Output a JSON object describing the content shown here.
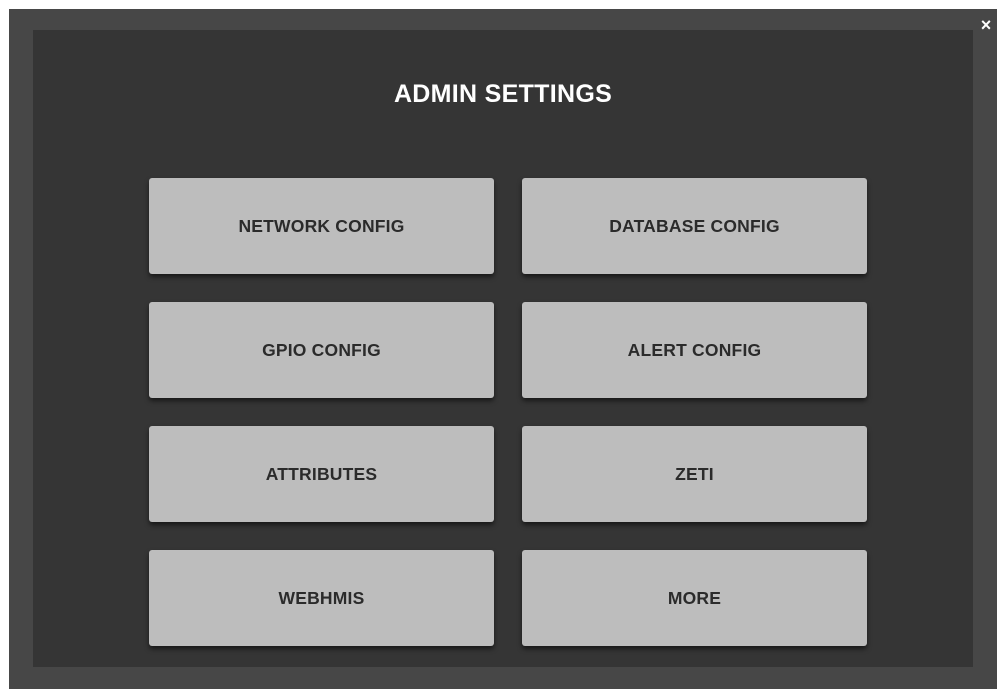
{
  "modal": {
    "title": "ADMIN SETTINGS",
    "close_icon": "×"
  },
  "buttons": [
    {
      "label": "NETWORK CONFIG"
    },
    {
      "label": "DATABASE CONFIG"
    },
    {
      "label": "GPIO CONFIG"
    },
    {
      "label": "ALERT CONFIG"
    },
    {
      "label": "ATTRIBUTES"
    },
    {
      "label": "ZETI"
    },
    {
      "label": "WEBHMIS"
    },
    {
      "label": "MORE"
    }
  ],
  "colors": {
    "overlay": "#474747",
    "panel": "#353535",
    "button": "#bdbdbd",
    "button_text": "#2b2b2b",
    "title_text": "#ffffff"
  }
}
